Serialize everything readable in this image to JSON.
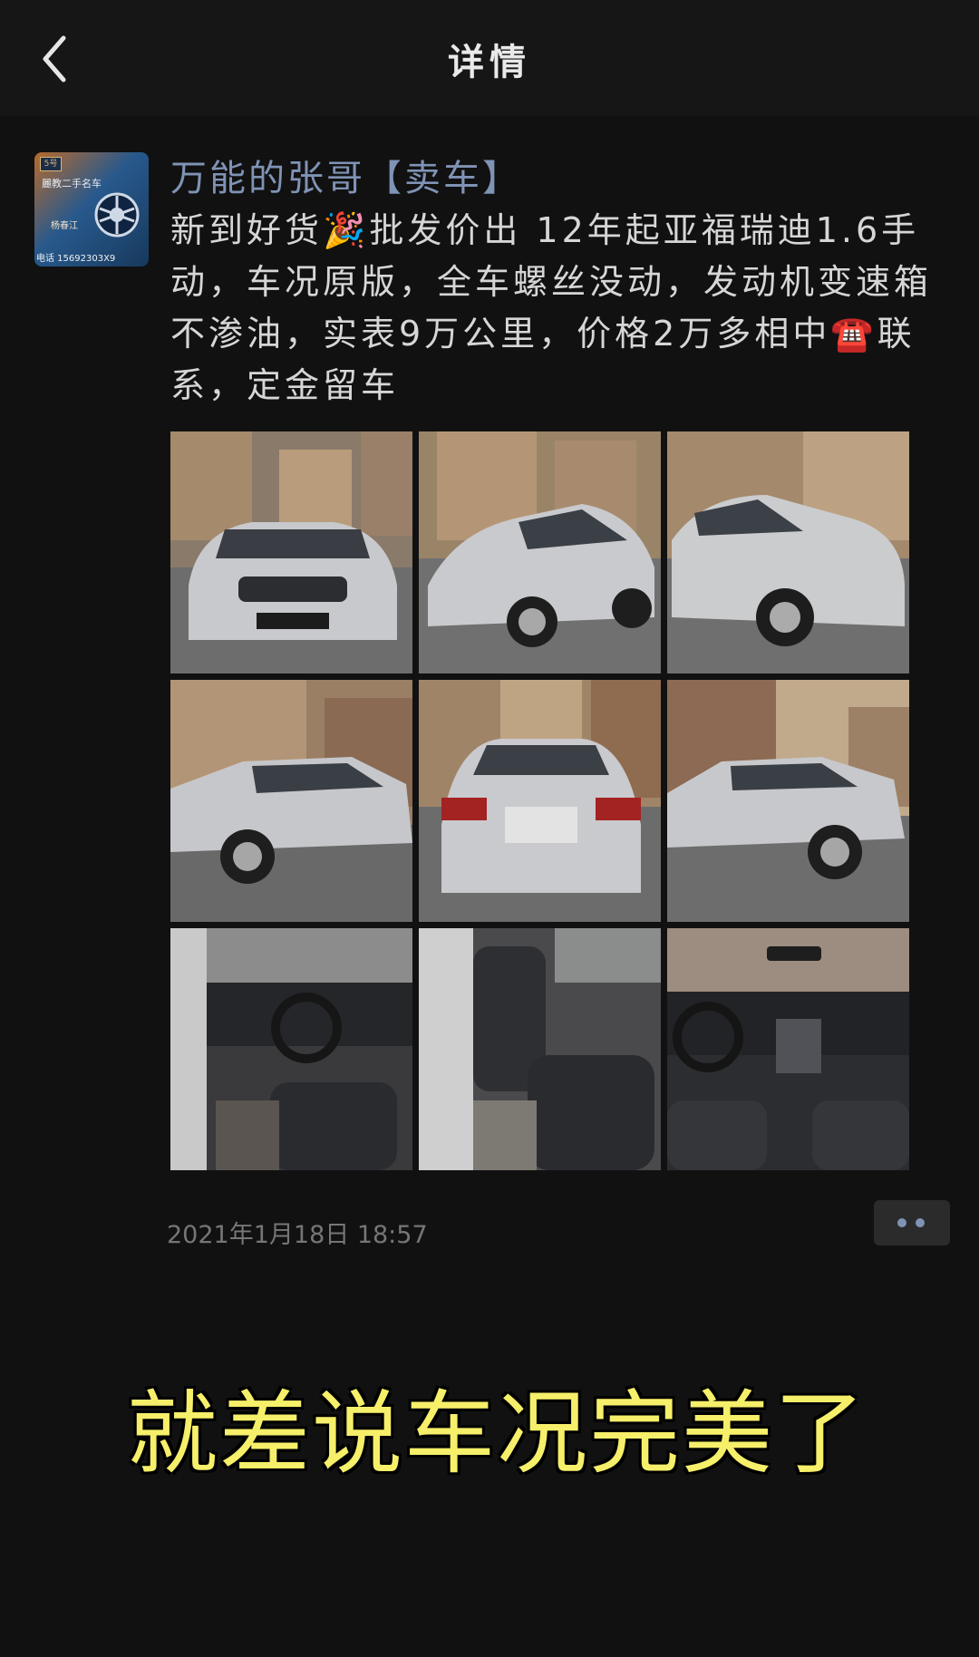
{
  "nav": {
    "title": "详情"
  },
  "post": {
    "author": "万能的张哥【卖车】",
    "text": "新到好货🎉批发价出 12年起亚福瑞迪1.6手动，车况原版，全车螺丝没动，发动机变速箱不渗油，实表9万公里，价格2万多相中☎️联系，定金留车",
    "timestamp": "2021年1月18日 18:57",
    "avatar": {
      "tag": "5号",
      "line1": "麗教二手名车",
      "name": "杨春江",
      "phone": "电话 15692303X9"
    }
  },
  "photos": [
    {
      "name": "car-front-view"
    },
    {
      "name": "car-front-left-view"
    },
    {
      "name": "car-front-right-view"
    },
    {
      "name": "car-left-side-view"
    },
    {
      "name": "car-rear-view"
    },
    {
      "name": "car-right-side-view"
    },
    {
      "name": "car-driver-interior"
    },
    {
      "name": "car-seats-interior"
    },
    {
      "name": "car-dashboard-interior"
    }
  ],
  "overlay": {
    "caption": "就差说车况完美了"
  },
  "colors": {
    "background": "#111111",
    "author": "#7f93b5",
    "caption": "#f6ef6a"
  },
  "icons": {
    "back": "chevron-left-icon",
    "more": "more-dots-icon"
  }
}
